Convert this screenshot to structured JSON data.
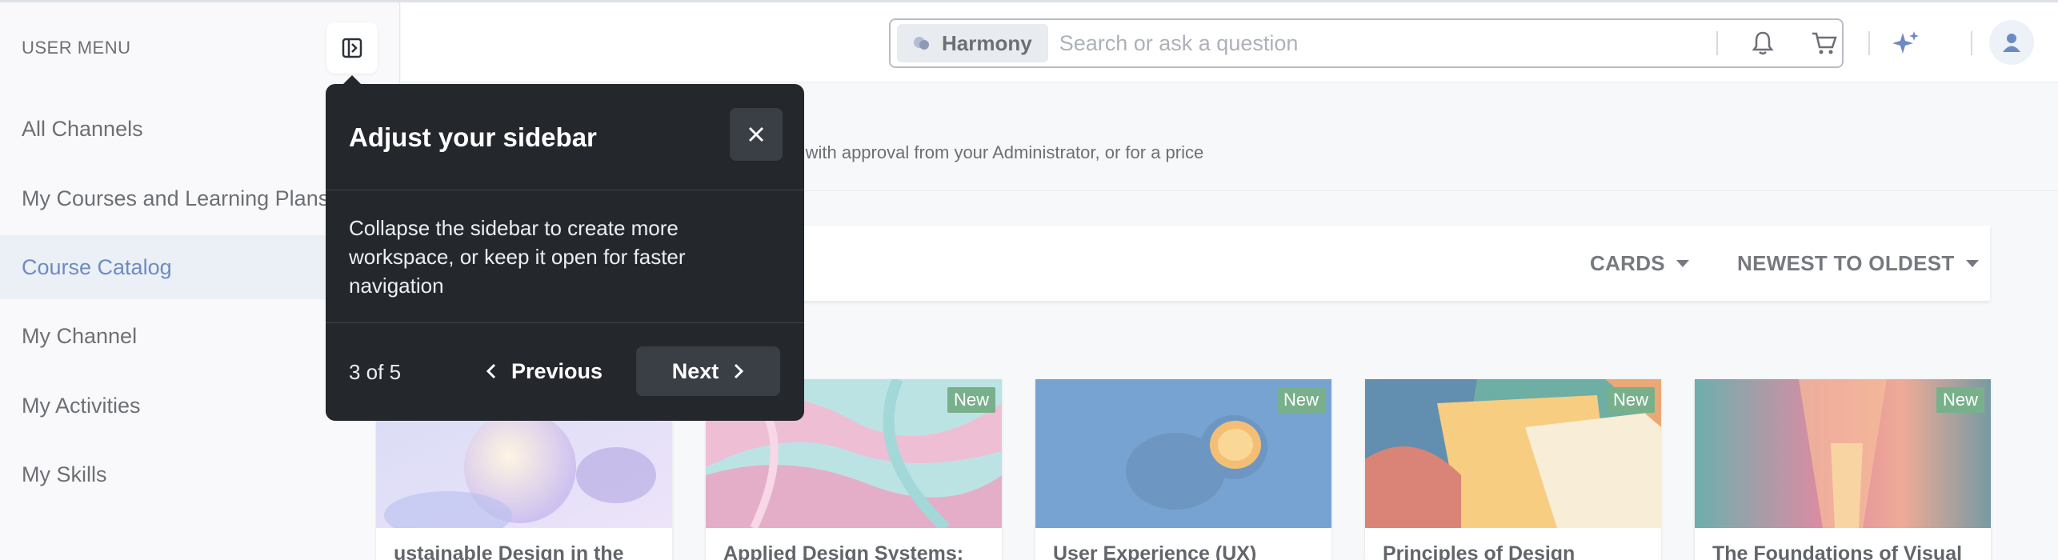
{
  "sidebar": {
    "title": "USER MENU",
    "items": [
      {
        "label": "All Channels"
      },
      {
        "label": "My Courses and Learning Plans"
      },
      {
        "label": "Course Catalog",
        "active": true
      },
      {
        "label": "My Channel"
      },
      {
        "label": "My Activities"
      },
      {
        "label": "My Skills"
      }
    ]
  },
  "topbar": {
    "scope_label": "Harmony",
    "search_placeholder": "Search or ask a question",
    "icons": [
      "bell-icon",
      "cart-icon",
      "sparkle-icon",
      "user-icon"
    ]
  },
  "main": {
    "subtitle_fragment": "y, with approval from your Administrator, or for a price",
    "view_label": "CARDS",
    "sort_label": "NEWEST TO OLDEST",
    "cards": [
      {
        "title": "ustainable Design in the",
        "badge": ""
      },
      {
        "title": "Applied Design Systems:",
        "badge": "New"
      },
      {
        "title": "User Experience (UX)",
        "badge": "New"
      },
      {
        "title": "Principles of Design",
        "badge": "New"
      },
      {
        "title": "The Foundations of Visual",
        "badge": "New"
      }
    ]
  },
  "popover": {
    "title": "Adjust your sidebar",
    "body": "Collapse the sidebar to create more workspace, or keep it open for faster navigation",
    "step": "3 of 5",
    "previous_label": "Previous",
    "next_label": "Next"
  },
  "colors": {
    "accent": "#2f5aa8",
    "popover_bg": "#24272c",
    "badge": "#3e8f5a"
  }
}
